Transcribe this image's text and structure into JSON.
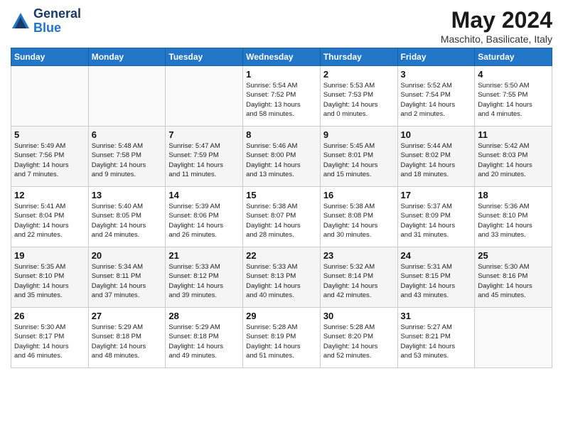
{
  "logo": {
    "line1": "General",
    "line2": "Blue"
  },
  "title": "May 2024",
  "subtitle": "Maschito, Basilicate, Italy",
  "days_of_week": [
    "Sunday",
    "Monday",
    "Tuesday",
    "Wednesday",
    "Thursday",
    "Friday",
    "Saturday"
  ],
  "weeks": [
    [
      {
        "day": "",
        "info": ""
      },
      {
        "day": "",
        "info": ""
      },
      {
        "day": "",
        "info": ""
      },
      {
        "day": "1",
        "info": "Sunrise: 5:54 AM\nSunset: 7:52 PM\nDaylight: 13 hours\nand 58 minutes."
      },
      {
        "day": "2",
        "info": "Sunrise: 5:53 AM\nSunset: 7:53 PM\nDaylight: 14 hours\nand 0 minutes."
      },
      {
        "day": "3",
        "info": "Sunrise: 5:52 AM\nSunset: 7:54 PM\nDaylight: 14 hours\nand 2 minutes."
      },
      {
        "day": "4",
        "info": "Sunrise: 5:50 AM\nSunset: 7:55 PM\nDaylight: 14 hours\nand 4 minutes."
      }
    ],
    [
      {
        "day": "5",
        "info": "Sunrise: 5:49 AM\nSunset: 7:56 PM\nDaylight: 14 hours\nand 7 minutes."
      },
      {
        "day": "6",
        "info": "Sunrise: 5:48 AM\nSunset: 7:58 PM\nDaylight: 14 hours\nand 9 minutes."
      },
      {
        "day": "7",
        "info": "Sunrise: 5:47 AM\nSunset: 7:59 PM\nDaylight: 14 hours\nand 11 minutes."
      },
      {
        "day": "8",
        "info": "Sunrise: 5:46 AM\nSunset: 8:00 PM\nDaylight: 14 hours\nand 13 minutes."
      },
      {
        "day": "9",
        "info": "Sunrise: 5:45 AM\nSunset: 8:01 PM\nDaylight: 14 hours\nand 15 minutes."
      },
      {
        "day": "10",
        "info": "Sunrise: 5:44 AM\nSunset: 8:02 PM\nDaylight: 14 hours\nand 18 minutes."
      },
      {
        "day": "11",
        "info": "Sunrise: 5:42 AM\nSunset: 8:03 PM\nDaylight: 14 hours\nand 20 minutes."
      }
    ],
    [
      {
        "day": "12",
        "info": "Sunrise: 5:41 AM\nSunset: 8:04 PM\nDaylight: 14 hours\nand 22 minutes."
      },
      {
        "day": "13",
        "info": "Sunrise: 5:40 AM\nSunset: 8:05 PM\nDaylight: 14 hours\nand 24 minutes."
      },
      {
        "day": "14",
        "info": "Sunrise: 5:39 AM\nSunset: 8:06 PM\nDaylight: 14 hours\nand 26 minutes."
      },
      {
        "day": "15",
        "info": "Sunrise: 5:38 AM\nSunset: 8:07 PM\nDaylight: 14 hours\nand 28 minutes."
      },
      {
        "day": "16",
        "info": "Sunrise: 5:38 AM\nSunset: 8:08 PM\nDaylight: 14 hours\nand 30 minutes."
      },
      {
        "day": "17",
        "info": "Sunrise: 5:37 AM\nSunset: 8:09 PM\nDaylight: 14 hours\nand 31 minutes."
      },
      {
        "day": "18",
        "info": "Sunrise: 5:36 AM\nSunset: 8:10 PM\nDaylight: 14 hours\nand 33 minutes."
      }
    ],
    [
      {
        "day": "19",
        "info": "Sunrise: 5:35 AM\nSunset: 8:10 PM\nDaylight: 14 hours\nand 35 minutes."
      },
      {
        "day": "20",
        "info": "Sunrise: 5:34 AM\nSunset: 8:11 PM\nDaylight: 14 hours\nand 37 minutes."
      },
      {
        "day": "21",
        "info": "Sunrise: 5:33 AM\nSunset: 8:12 PM\nDaylight: 14 hours\nand 39 minutes."
      },
      {
        "day": "22",
        "info": "Sunrise: 5:33 AM\nSunset: 8:13 PM\nDaylight: 14 hours\nand 40 minutes."
      },
      {
        "day": "23",
        "info": "Sunrise: 5:32 AM\nSunset: 8:14 PM\nDaylight: 14 hours\nand 42 minutes."
      },
      {
        "day": "24",
        "info": "Sunrise: 5:31 AM\nSunset: 8:15 PM\nDaylight: 14 hours\nand 43 minutes."
      },
      {
        "day": "25",
        "info": "Sunrise: 5:30 AM\nSunset: 8:16 PM\nDaylight: 14 hours\nand 45 minutes."
      }
    ],
    [
      {
        "day": "26",
        "info": "Sunrise: 5:30 AM\nSunset: 8:17 PM\nDaylight: 14 hours\nand 46 minutes."
      },
      {
        "day": "27",
        "info": "Sunrise: 5:29 AM\nSunset: 8:18 PM\nDaylight: 14 hours\nand 48 minutes."
      },
      {
        "day": "28",
        "info": "Sunrise: 5:29 AM\nSunset: 8:18 PM\nDaylight: 14 hours\nand 49 minutes."
      },
      {
        "day": "29",
        "info": "Sunrise: 5:28 AM\nSunset: 8:19 PM\nDaylight: 14 hours\nand 51 minutes."
      },
      {
        "day": "30",
        "info": "Sunrise: 5:28 AM\nSunset: 8:20 PM\nDaylight: 14 hours\nand 52 minutes."
      },
      {
        "day": "31",
        "info": "Sunrise: 5:27 AM\nSunset: 8:21 PM\nDaylight: 14 hours\nand 53 minutes."
      },
      {
        "day": "",
        "info": ""
      }
    ]
  ]
}
